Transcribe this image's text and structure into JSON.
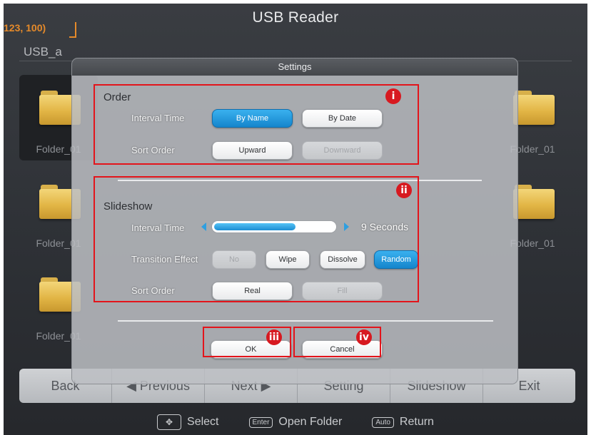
{
  "app": {
    "title": "USB Reader",
    "coordinate_readout": "123, 100)",
    "drive_label": "USB_a",
    "tiles": [
      {
        "label": "Folder_01"
      },
      {
        "label": "Folder_01"
      },
      {
        "label": "Folder_01"
      },
      {
        "label": "Folder_01"
      },
      {
        "label": "Folder_01"
      },
      {
        "label": "Folder_01"
      },
      {
        "label": "Folder_01"
      },
      {
        "label": "Folder_01"
      }
    ],
    "nav": {
      "back": "Back",
      "previous": "◀ Previous",
      "next": "Next ▶",
      "setting": "Setting",
      "slideshow": "Slideshow",
      "exit": "Exit"
    },
    "hints": {
      "select_key": "✥",
      "select": "Select",
      "open_key": "Enter",
      "open": "Open Folder",
      "return_key": "Auto",
      "return": "Return"
    }
  },
  "dialog": {
    "title": "Settings",
    "order": {
      "title": "Order",
      "interval_label": "Interval Time",
      "by_name": "By Name",
      "by_date": "By Date",
      "sort_label": "Sort Order",
      "upward": "Upward",
      "downward": "Downward"
    },
    "slideshow": {
      "title": "Slideshow",
      "interval_label": "Interval Time",
      "interval_value": "9 Seconds",
      "interval_fraction": 0.68,
      "transition_label": "Transition Effect",
      "no": "No",
      "wipe": "Wipe",
      "dissolve": "Dissolve",
      "random": "Random",
      "sort_label": "Sort Order",
      "real": "Real",
      "fill": "Fill"
    },
    "ok": "OK",
    "cancel": "Cancel"
  },
  "callouts": {
    "i": "i",
    "ii": "ii",
    "iii": "iii",
    "iv": "iv"
  },
  "colors": {
    "accent_blue": "#1c8ed3",
    "callout_red": "#e3141b",
    "folder_yellow": "#e2b545"
  }
}
